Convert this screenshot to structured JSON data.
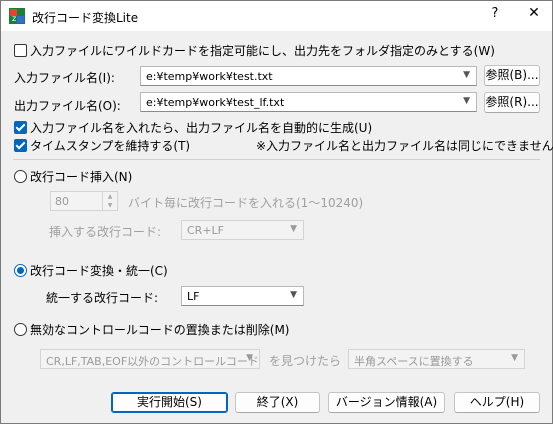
{
  "window": {
    "title": "改行コード変換Lite",
    "help_glyph": "?",
    "close_glyph": "✕"
  },
  "options": {
    "wildcard_label": "入力ファイルにワイルドカードを指定可能にし、出力先をフォルダ指定のみとする(W)",
    "wildcard_checked": false
  },
  "input_file": {
    "label": "入力ファイル名(I):",
    "value": "e:¥temp¥work¥test.txt",
    "browse_label": "参照(B)..."
  },
  "output_file": {
    "label": "出力ファイル名(O):",
    "value": "e:¥temp¥work¥test_lf.txt",
    "browse_label": "参照(R)..."
  },
  "auto_output": {
    "label": "入力ファイル名を入れたら、出力ファイル名を自動的に生成(U)",
    "checked": true
  },
  "timestamp": {
    "label": "タイムスタンプを維持する(T)",
    "checked": true
  },
  "note": "※入力ファイル名と出力ファイル名は同じにできません。",
  "insert_mode": {
    "label": "改行コード挿入(N)",
    "selected": false,
    "bytes_value": "80",
    "bytes_desc": "バイト毎に改行コードを入れる(1〜10240)",
    "code_label": "挿入する改行コード:",
    "code_value": "CR+LF"
  },
  "convert_mode": {
    "label": "改行コード変換・統一(C)",
    "selected": true,
    "code_label": "統一する改行コード:",
    "code_value": "LF"
  },
  "control_mode": {
    "label": "無効なコントロールコードの置換または削除(M)",
    "selected": false,
    "target_value": "CR,LF,TAB,EOF以外のコントロールコード",
    "found_label": "を見つけたら",
    "action_value": "半角スペースに置換する"
  },
  "buttons": {
    "run": "実行開始(S)",
    "exit": "終了(X)",
    "version": "バージョン情報(A)",
    "help": "ヘルプ(H)"
  },
  "colors": {
    "accent": "#0067c0",
    "disabled_text": "#a0a0a0",
    "dialog_bg": "#f0f0f0"
  }
}
